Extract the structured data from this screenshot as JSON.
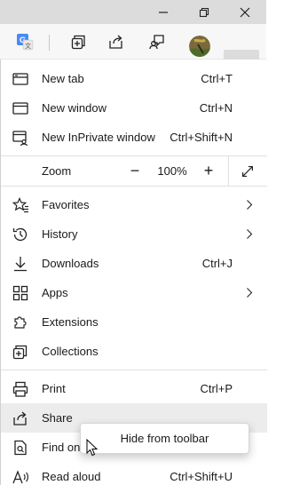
{
  "titlebar": {
    "buttons": [
      "minimize-icon",
      "restore-icon",
      "close-icon"
    ]
  },
  "toolbar": {
    "icons": [
      "translate-icon",
      "collections-icon",
      "share-icon",
      "feedback-icon",
      "profile-avatar",
      "more-icon"
    ],
    "accent": "#1a73e8"
  },
  "menu": {
    "new_tab": {
      "label": "New tab",
      "shortcut": "Ctrl+T"
    },
    "new_window": {
      "label": "New window",
      "shortcut": "Ctrl+N"
    },
    "new_inprivate": {
      "label": "New InPrivate window",
      "shortcut": "Ctrl+Shift+N"
    },
    "zoom": {
      "label": "Zoom",
      "minus": "−",
      "value": "100%",
      "plus": "+"
    },
    "favorites": {
      "label": "Favorites"
    },
    "history": {
      "label": "History"
    },
    "downloads": {
      "label": "Downloads",
      "shortcut": "Ctrl+J"
    },
    "apps": {
      "label": "Apps"
    },
    "extensions": {
      "label": "Extensions"
    },
    "collections": {
      "label": "Collections"
    },
    "print": {
      "label": "Print",
      "shortcut": "Ctrl+P"
    },
    "share": {
      "label": "Share"
    },
    "find": {
      "label": "Find on"
    },
    "read_aloud": {
      "label": "Read aloud",
      "shortcut": "Ctrl+Shift+U"
    }
  },
  "context_menu": {
    "hide_from_toolbar": "Hide from toolbar"
  },
  "colors": {
    "menu_bg": "#ffffff",
    "hover_bg": "#ececec",
    "titlebar_bg": "#dcdcdc"
  }
}
